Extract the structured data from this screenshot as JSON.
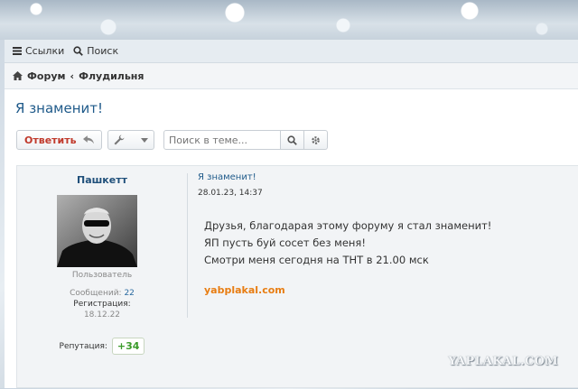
{
  "topnav": {
    "links_label": "Ссылки",
    "search_label": "Поиск"
  },
  "breadcrumb": {
    "forum": "Форум",
    "separator": "‹",
    "section": "Флудильня"
  },
  "thread": {
    "title": "Я знаменит!"
  },
  "toolbar": {
    "reply_label": "Ответить",
    "search_placeholder": "Поиск в теме..."
  },
  "post": {
    "author": "Пашкетт",
    "user_title": "Пользователь",
    "messages_label": "Сообщений:",
    "messages_count": "22",
    "registration_label": "Регистрация:",
    "registration_date": "18.12.22",
    "reputation_label": "Репутация:",
    "reputation_value": "+34",
    "title": "Я знаменит!",
    "date": "28.01.23, 14:37",
    "lines": [
      "Друзья, благодарая этому форуму я стал знаменит!",
      "ЯП пусть буй сосет без меня!",
      "Смотри меня сегодня на ТНТ в 21.00 мск"
    ],
    "site_link": "yabplakal.com"
  },
  "watermark": "YAPLAKAL.COM",
  "colors": {
    "accent": "#1f5a8a",
    "reply": "#c0392b",
    "link_orange": "#e87d12",
    "reputation": "#3a9a2a"
  }
}
